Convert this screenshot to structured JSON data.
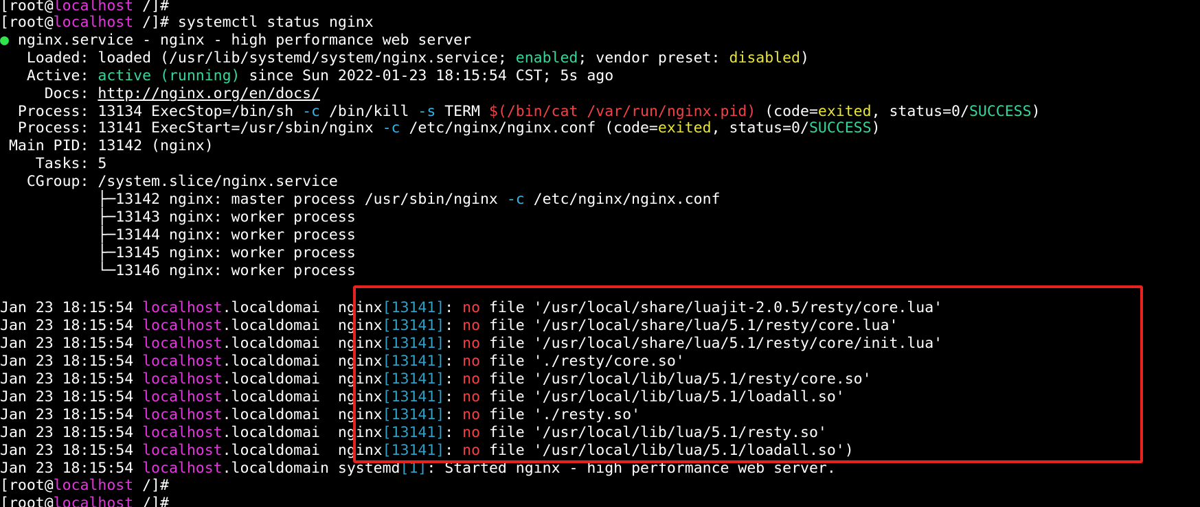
{
  "terminal": {
    "colors": {
      "background": "#000000",
      "text": "#ffffff",
      "host_magenta": "#e535e0",
      "status_green": "#35d79a",
      "status_yellow": "#e8e43a",
      "flag_cyan": "#35b5e6",
      "pid_blue": "#2fa0c8",
      "error_red": "#f04248",
      "bullet_green": "#2fe64a",
      "highlight_box": "#e8231f"
    },
    "prompt": {
      "open": "[root@",
      "host": "localhost",
      "path": " /]#"
    },
    "command": " systemctl status nginx",
    "service": {
      "bullet": "●",
      "unit_line": " nginx.service - nginx - high performance web server",
      "loaded_label": "   Loaded: ",
      "loaded_text": "loaded (/usr/lib/systemd/system/nginx.service; ",
      "loaded_enabled": "enabled",
      "loaded_mid": "; vendor preset: ",
      "loaded_disabled": "disabled",
      "loaded_end": ")",
      "active_label": "   Active: ",
      "active_state": "active (running)",
      "active_since": " since Sun 2022-01-23 18:15:54 CST; 5s ago",
      "docs_label": "     Docs: ",
      "docs_url": "http://nginx.org/en/docs/",
      "process1": {
        "label": "  Process: ",
        "a": "13134 ExecStop=/bin/sh ",
        "flag1": "-c",
        "b": " /bin/kill ",
        "flag2": "-s",
        "c": " TERM ",
        "subst": "$(/bin/cat /var/run/nginx.pid)",
        "d": " (code=",
        "code": "exited",
        "e": ", status=0/",
        "status": "SUCCESS",
        "f": ")"
      },
      "process2": {
        "label": "  Process: ",
        "a": "13141 ExecStart=/usr/sbin/nginx ",
        "flag1": "-c",
        "b": " /etc/nginx/nginx.conf (code=",
        "code": "exited",
        "c": ", status=0/",
        "status": "SUCCESS",
        "d": ")"
      },
      "main_pid": " Main PID: 13142 (nginx)",
      "tasks": "    Tasks: 5",
      "cgroup": "   CGroup: /system.slice/nginx.service",
      "tree": [
        {
          "prefix": "           ├─13142 nginx: master process /usr/sbin/nginx ",
          "flag": "-c",
          "suffix": " /etc/nginx/nginx.conf"
        },
        {
          "prefix": "           ├─13143 nginx: worker process",
          "flag": "",
          "suffix": ""
        },
        {
          "prefix": "           ├─13144 nginx: worker process",
          "flag": "",
          "suffix": ""
        },
        {
          "prefix": "           ├─13145 nginx: worker process",
          "flag": "",
          "suffix": ""
        },
        {
          "prefix": "           └─13146 nginx: worker process",
          "flag": "",
          "suffix": ""
        }
      ]
    },
    "log": {
      "date": "Jan 23 18:15:54 ",
      "host": "localhost",
      "domain": ".localdomain",
      "truncated_domain": ".localdomai",
      "nginx_proc": "nginx",
      "nginx_pid": "[13141]",
      "colon": ": ",
      "no": "no",
      "nginx_lines": [
        " file '/usr/local/share/luajit-2.0.5/resty/core.lua'",
        " file '/usr/local/share/lua/5.1/resty/core.lua'",
        " file '/usr/local/share/lua/5.1/resty/core/init.lua'",
        " file './resty/core.so'",
        " file '/usr/local/lib/lua/5.1/resty/core.so'",
        " file '/usr/local/lib/lua/5.1/loadall.so'",
        " file './resty.so'",
        " file '/usr/local/lib/lua/5.1/resty.so'",
        " file '/usr/local/lib/lua/5.1/loadall.so')"
      ],
      "systemd_proc": " systemd",
      "systemd_pid": "[1]",
      "systemd_msg": ": Started nginx - high performance web server."
    }
  }
}
